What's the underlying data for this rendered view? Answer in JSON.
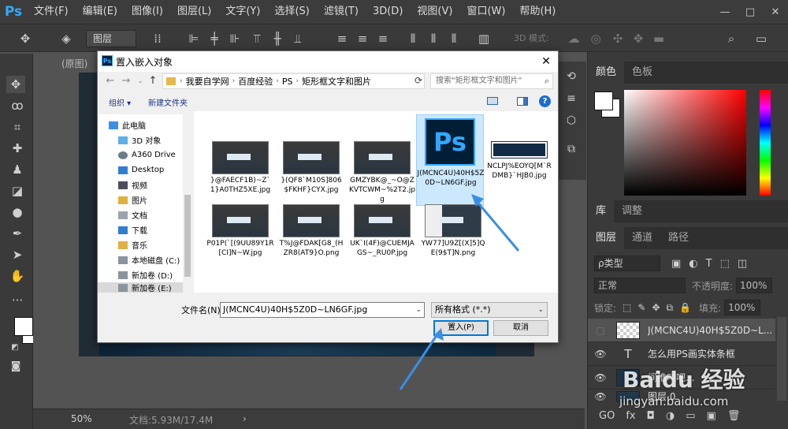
{
  "app": {
    "logo": "Ps",
    "menu": [
      "文件(F)",
      "编辑(E)",
      "图像(I)",
      "图层(L)",
      "文字(Y)",
      "选择(S)",
      "滤镜(T)",
      "3D(D)",
      "视图(V)",
      "窗口(W)",
      "帮助(H)"
    ],
    "window_controls": [
      "—",
      "□",
      "✕"
    ]
  },
  "options_bar": {
    "layer_select": "图层",
    "mode_3d": "3D 模式:"
  },
  "document": {
    "tab_label": "(原图)",
    "zoom": "50%",
    "doc_size": "文档:5.93M/17.4M",
    "status_arrow": "›"
  },
  "right_panel": {
    "color_tabs": [
      "颜色",
      "色板"
    ],
    "library_tabs": [
      "库",
      "调整"
    ],
    "layer_tabs": [
      "图层",
      "通道",
      "路径"
    ],
    "filter_kind": "ρ类型",
    "blend_mode": "正常",
    "opacity_label": "不透明度:",
    "opacity_value": "100%",
    "lock_label": "锁定:",
    "fill_label": "填充:",
    "fill_value": "100%",
    "layers": [
      {
        "name": "J(MCNC4U)40H$5Z0D~L...",
        "kind": "smart",
        "selected": true
      },
      {
        "name": "怎么用PS画实体条框",
        "kind": "text",
        "selected": false
      },
      {
        "name": "间推叫吧...",
        "kind": "image",
        "selected": false
      },
      {
        "name": "图层 0",
        "kind": "image",
        "selected": false
      }
    ],
    "bottom_icons": [
      "GO",
      "fx",
      "◘",
      "◑",
      "▭",
      "▣",
      "🗑"
    ]
  },
  "dialog": {
    "title": "置入嵌入对象",
    "close": "✕",
    "breadcrumbs": [
      "我要自学网",
      "百度经验",
      "PS",
      "矩形框文字和图片"
    ],
    "search_placeholder": "搜索\"矩形框文字和图片\"",
    "organize": "组织 ▾",
    "new_folder": "新建文件夹",
    "nav_items": [
      "此电脑",
      "3D 对象",
      "A360 Drive",
      "Desktop",
      "视频",
      "图片",
      "文档",
      "下载",
      "音乐",
      "本地磁盘 (C:)",
      "新加卷 (D:)",
      "新加卷 (E:)"
    ],
    "files": [
      {
        "name": "}@FAECF1B)~Z`1}A0THZ5XE.jpg",
        "thumb": "screenshot"
      },
      {
        "name": "}(QF8`M10S]806$FKHF}CYX.jpg",
        "thumb": "screenshot"
      },
      {
        "name": "GMZYBK@_~O@ZKVTCWM~%2T2.jpg",
        "thumb": "screenshot"
      },
      {
        "name": "J(MCNC4U)40H$5Z0D~LN6GF.jpg",
        "thumb": "ps-icon",
        "selected": true
      },
      {
        "name": "NCLPJ%EOYQ[M`RDMB}`HJB0.jpg",
        "thumb": "logo"
      },
      {
        "name": "P01P(`[(9UU89Y1R[CI]N~W.jpg",
        "thumb": "screenshot"
      },
      {
        "name": "T%J@FDAK[G8_(HZR8(AT9}O.png",
        "thumb": "screenshot"
      },
      {
        "name": "UK`I(4F)@CUEMJAGS~_RU0P.jpg",
        "thumb": "screenshot"
      },
      {
        "name": "YW77]U9Z[(X]5]QE(9$T]N.png",
        "thumb": "screenshot"
      }
    ],
    "filename_label": "文件名(N):",
    "filename_value": "J(MCNC4U)40H$5Z0D~LN6GF.jpg",
    "filetype": "所有格式 (*.*)",
    "place_button": "置入(P)",
    "cancel_button": "取消"
  },
  "watermark": {
    "brand": "Baidu 经验",
    "url": "jingyan.baidu.com"
  }
}
